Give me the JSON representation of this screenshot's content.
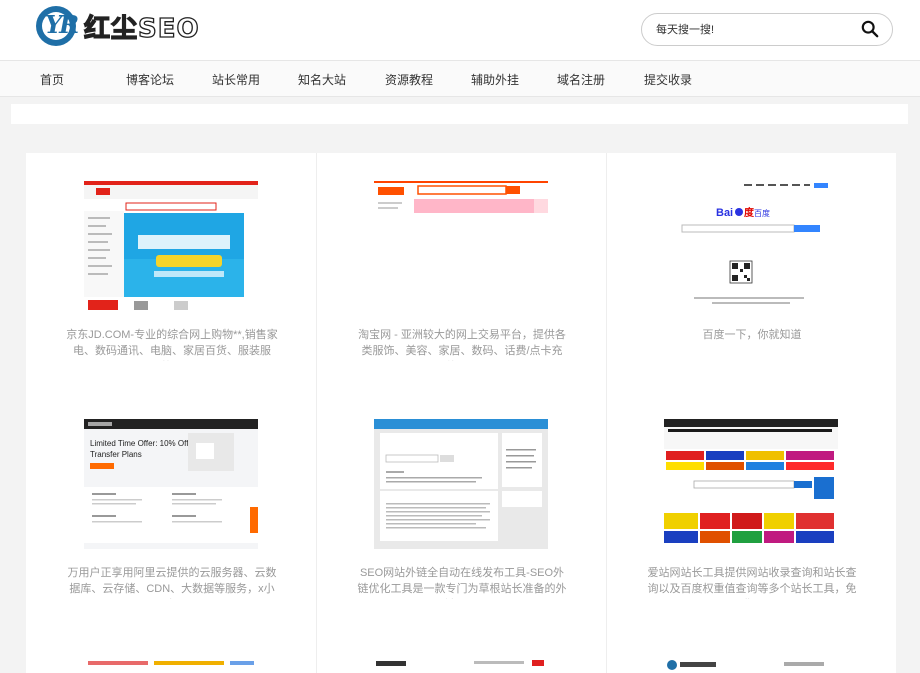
{
  "header": {
    "logo_mark": "YR",
    "logo_text": "红尘SEO",
    "search": {
      "placeholder": "每天搜一搜!"
    }
  },
  "nav": {
    "items": [
      {
        "label": "首页"
      },
      {
        "label": "博客论坛"
      },
      {
        "label": "站长常用"
      },
      {
        "label": "知名大站"
      },
      {
        "label": "资源教程"
      },
      {
        "label": "辅助外挂"
      },
      {
        "label": "域名注册"
      },
      {
        "label": "提交收录"
      }
    ]
  },
  "cards": [
    {
      "desc": "京东JD.COM-专业的综合网上购物**,销售家电、数码通讯、电脑、家居百货、服装服饰..."
    },
    {
      "desc": "淘宝网 - 亚洲较大的网上交易平台，提供各类服饰、美容、家居、数码、话费/点卡充值... ..."
    },
    {
      "desc": "百度一下，你就知道",
      "thumb_logo": "Bai度百度"
    },
    {
      "desc": "万用户正享用阿里云提供的云服务器、云数据库、云存储、CDN、大数据等服务，x小时...",
      "thumb_text": "Limited Time Offer: 10% Off D Transfer Plans"
    },
    {
      "desc": "SEO网站外链全自动在线发布工具-SEO外链优化工具是一款专门为草根站长准备的外链SE..."
    },
    {
      "desc": "爱站网站长工具提供网站收录查询和站长查询以及百度权重值查询等多个站长工具，免费..."
    }
  ],
  "colors": {
    "brand": "#1f6fa7",
    "text": "#333333",
    "muted": "#999999"
  }
}
